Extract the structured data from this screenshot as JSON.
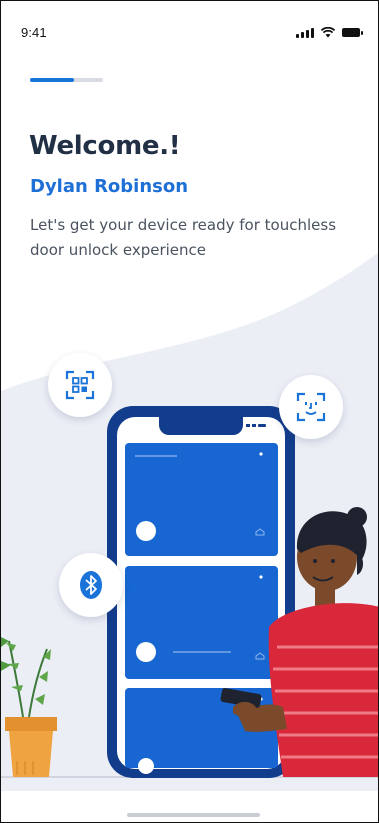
{
  "status_bar": {
    "time": "9:41"
  },
  "onboarding": {
    "progress": 0.6,
    "title": "Welcome.!",
    "username": "Dylan Robinson",
    "subtitle": "Let's get your device ready for touchless door unlock experience"
  },
  "features": [
    {
      "icon": "qr-code-icon"
    },
    {
      "icon": "face-id-icon"
    },
    {
      "icon": "bluetooth-icon"
    }
  ],
  "colors": {
    "primary": "#1a73d9",
    "title": "#223046",
    "background_wave": "#eceef6",
    "card_blue": "#1766d1",
    "phone_frame": "#123c8c",
    "shirt_red": "#d9283a"
  }
}
